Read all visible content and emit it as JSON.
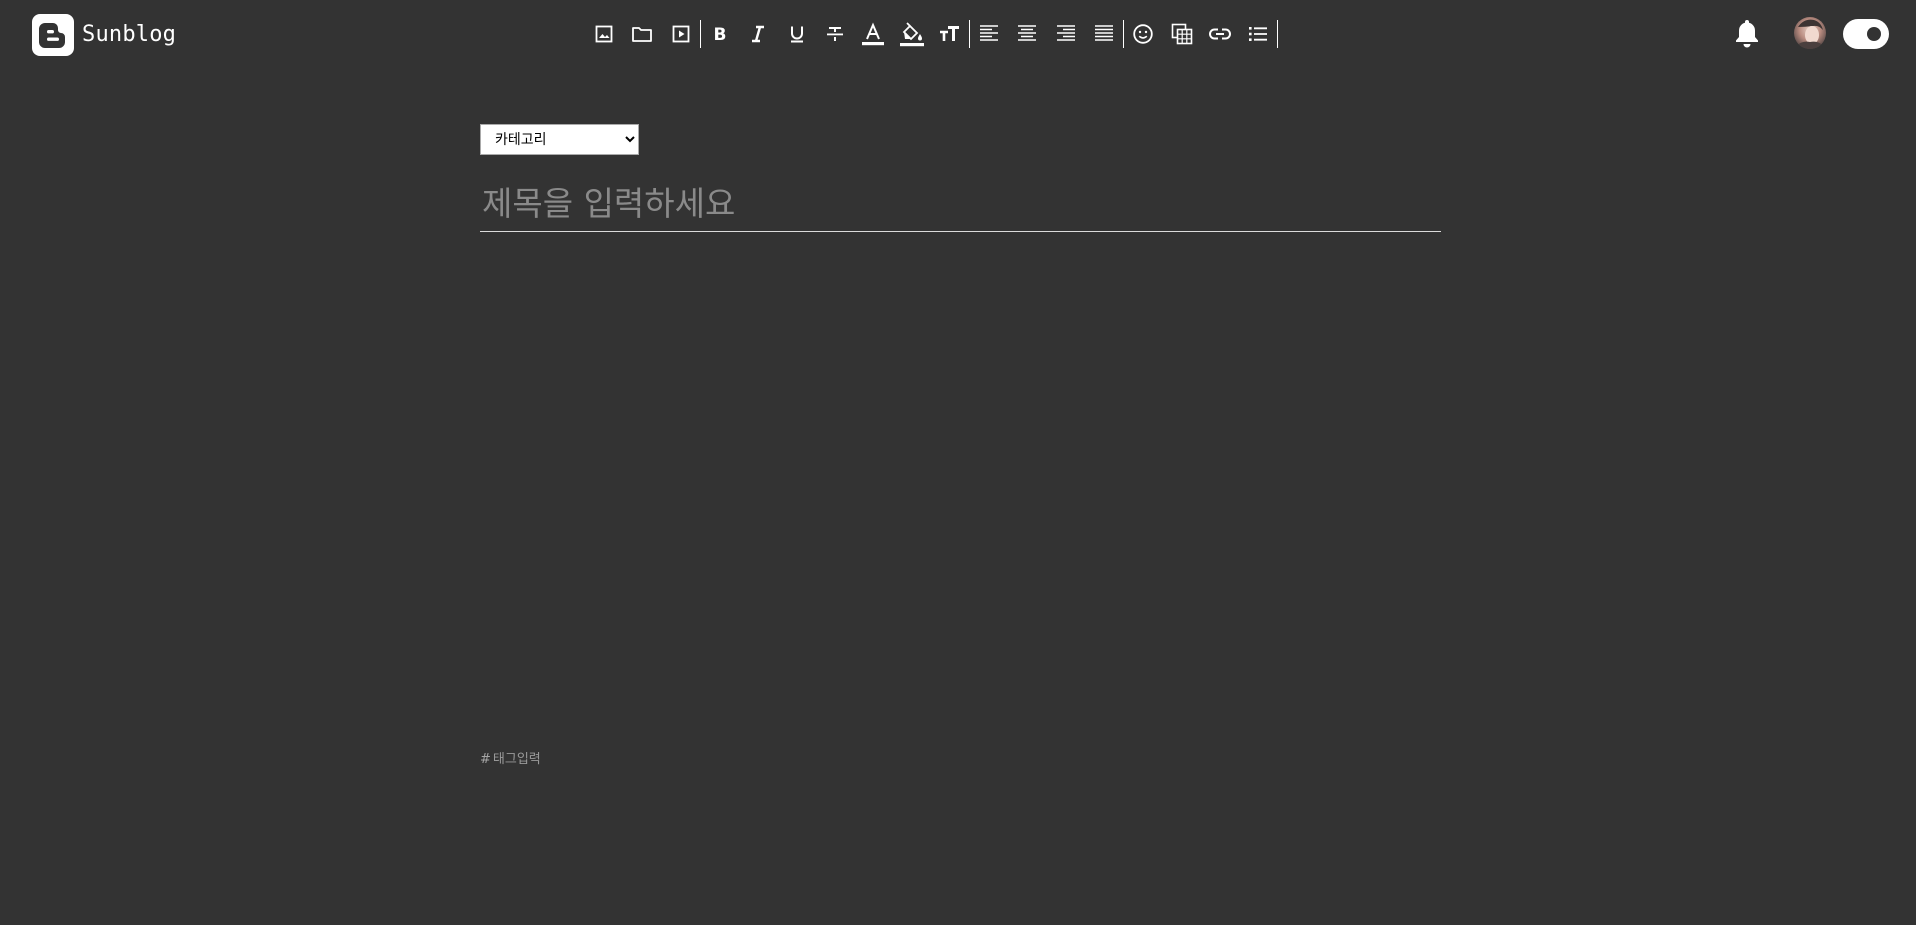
{
  "brand": {
    "name": "Sunblog"
  },
  "theme": {
    "background": "#333333",
    "foreground": "#ffffff"
  },
  "toolbar": {
    "groups": [
      [
        "image-icon",
        "folder-icon",
        "video-icon"
      ],
      [
        "bold-icon",
        "italic-icon",
        "underline-icon",
        "strikethrough-icon",
        "font-color-icon",
        "highlight-color-icon",
        "font-size-icon"
      ],
      [
        "align-left-icon",
        "align-center-icon",
        "align-right-icon",
        "align-justify-icon"
      ],
      [
        "emoji-icon",
        "table-icon",
        "link-icon",
        "bullet-list-icon"
      ]
    ]
  },
  "header": {
    "notification_icon": "bell-icon",
    "avatar": "avatar",
    "theme_toggle": "dark-mode-toggle"
  },
  "editor": {
    "category": {
      "selected": "카테고리",
      "options": [
        "카테고리"
      ]
    },
    "title_placeholder": "제목을 입력하세요",
    "tag": {
      "hash": "#",
      "placeholder": "태그입력"
    }
  }
}
